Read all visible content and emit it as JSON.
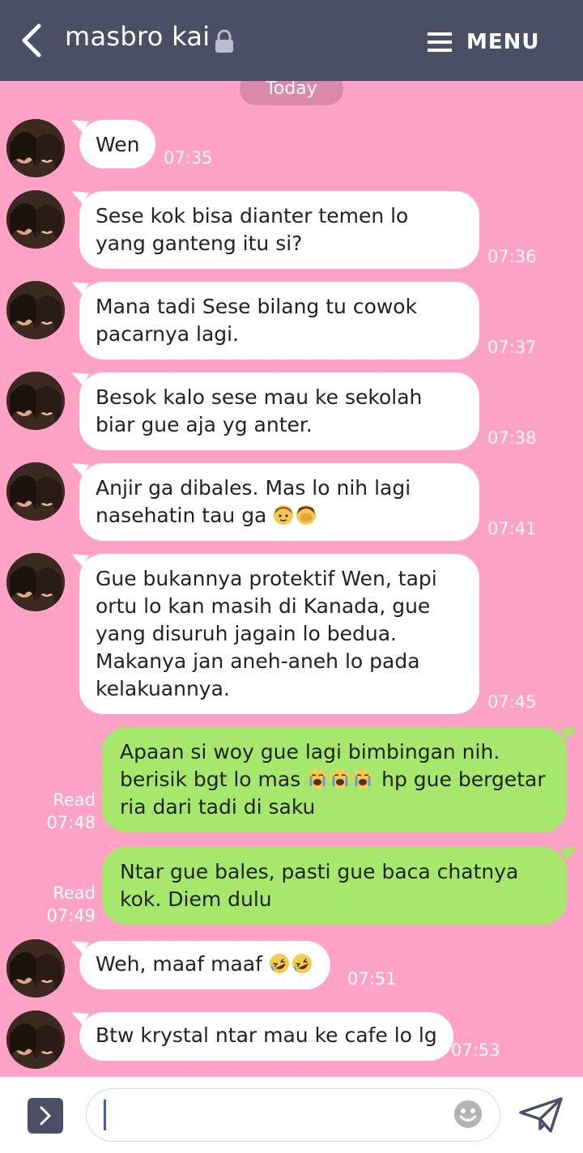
{
  "header": {
    "contact_name": "masbro kai",
    "menu_label": "MENU",
    "icons": {
      "back": "chevron-left-icon",
      "lock": "lock-icon",
      "menu": "hamburger-icon"
    }
  },
  "date_pill": "Today",
  "messages": [
    {
      "dir": "in",
      "text": "Wen",
      "time": "07:35"
    },
    {
      "dir": "in",
      "text": "Sese kok bisa dianter temen lo yang ganteng itu si?",
      "time": "07:36"
    },
    {
      "dir": "in",
      "text": "Mana tadi Sese bilang tu cowok pacarnya lagi.",
      "time": "07:37"
    },
    {
      "dir": "in",
      "text": "Besok kalo sese mau ke sekolah biar gue aja yg anter.",
      "time": "07:38"
    },
    {
      "dir": "in",
      "text": "Anjir ga dibales. Mas lo nih lagi nasehatin tau ga",
      "emoji": [
        "person-getting-haircut",
        "facepalm"
      ],
      "time": "07:41"
    },
    {
      "dir": "in",
      "text": "Gue bukannya protektif Wen, tapi ortu lo kan masih di Kanada, gue yang disuruh jagain lo bedua. Makanya jan aneh-aneh lo pada kelakuannya.",
      "time": "07:45"
    },
    {
      "dir": "out",
      "text_before": "Apaan si woy gue lagi bimbingan nih. berisik bgt lo mas ",
      "emoji": [
        "loudly-crying",
        "loudly-crying",
        "loudly-crying"
      ],
      "text_after": " hp gue bergetar ria dari tadi di saku",
      "read": "Read",
      "time": "07:48"
    },
    {
      "dir": "out",
      "text": "Ntar gue bales, pasti gue baca chatnya kok. Diem dulu",
      "read": "Read",
      "time": "07:49"
    },
    {
      "dir": "in",
      "text": "Weh, maaf maaf",
      "emoji": [
        "rolling-laughing",
        "rolling-laughing"
      ],
      "time": "07:51"
    },
    {
      "dir": "in",
      "text": "Btw krystal ntar mau ke cafe lo lg",
      "time": "07:53"
    }
  ],
  "input": {
    "value": "",
    "icons": {
      "expand": "chevron-right-icon",
      "emoji": "smiley-icon",
      "send": "send-icon"
    }
  },
  "colors": {
    "header": "#4b4f66",
    "background": "#ffa2c6",
    "incoming_bubble": "#ffffff",
    "outgoing_bubble": "#a6e86c",
    "date_pill": "#d98aa9"
  }
}
